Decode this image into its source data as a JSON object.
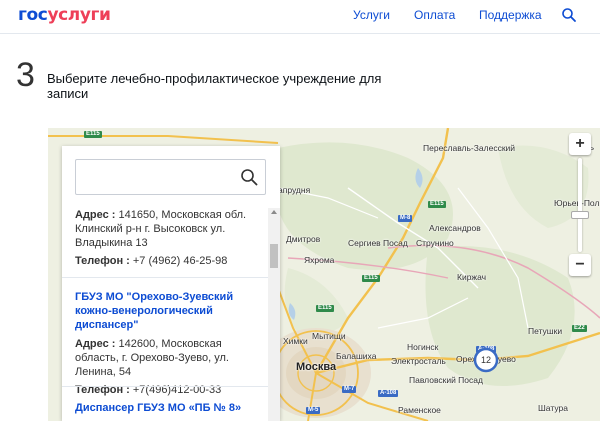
{
  "header": {
    "logo_part1": "гос",
    "logo_part2": "услуги",
    "nav": [
      {
        "label": "Услуги"
      },
      {
        "label": "Оплата"
      },
      {
        "label": "Поддержка"
      }
    ],
    "search_icon": "search-icon",
    "colors": {
      "brand_blue": "#0d4cd3",
      "brand_red": "#ee3f58"
    }
  },
  "step": {
    "number": "3",
    "title": "Выберите лечебно-профилактическое учреждение для записи"
  },
  "panel": {
    "search": {
      "value": "",
      "placeholder": "",
      "icon": "search-icon"
    },
    "address_label": "Адрес :",
    "phone_label": "Телефон :",
    "items": [
      {
        "name": "",
        "address": "141650, Московская обл. Клинский р-н г. Высоковск ул. Владыкина 13",
        "phone": "+7 (4962) 46-25-98"
      },
      {
        "name": "ГБУЗ МО \"Орехово-Зуевский кожно-венерологический диспансер\"",
        "address": "142600, Московская область, г. Орехово-Зуево, ул. Ленина, 54",
        "phone": "+7(496)412-00-33"
      },
      {
        "name": "Диспансер ГБУЗ МО «ПБ № 8»",
        "address": "",
        "phone": ""
      }
    ]
  },
  "map": {
    "zoom_in": "+",
    "zoom_out": "−",
    "cluster_count": "12",
    "cities": [
      {
        "name": "Москва",
        "big": true
      },
      {
        "name": "Переславль-Залесский"
      },
      {
        "name": "Юрьев-Польс"
      },
      {
        "name": "Александров"
      },
      {
        "name": "Сергиев Посад"
      },
      {
        "name": "Струнино"
      },
      {
        "name": "Дмитров"
      },
      {
        "name": "Яхрома"
      },
      {
        "name": "Киржач"
      },
      {
        "name": "Ногинск"
      },
      {
        "name": "Электросталь"
      },
      {
        "name": "Орехово-Зуево"
      },
      {
        "name": "Павловский Посад"
      },
      {
        "name": "Балашиха"
      },
      {
        "name": "Мытищи"
      },
      {
        "name": "Химки"
      },
      {
        "name": "Петушки"
      },
      {
        "name": "Раменское"
      },
      {
        "name": "Шатура"
      },
      {
        "name": "апрудня"
      },
      {
        "name": "Поль"
      }
    ],
    "roads": [
      "E115",
      "M-8",
      "E115",
      "E115",
      "E115",
      "A-108",
      "E22",
      "M-7",
      "M-5",
      "A-108"
    ]
  }
}
